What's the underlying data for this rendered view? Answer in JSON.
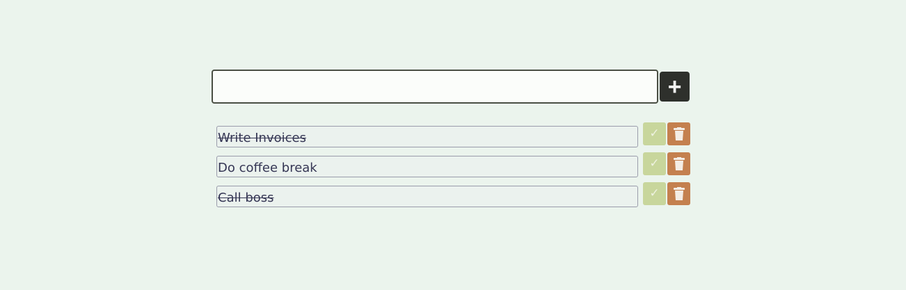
{
  "input": {
    "value": "",
    "placeholder": ""
  },
  "add_button": {
    "label": "+"
  },
  "tasks": [
    {
      "text": "Write Invoices",
      "done": true
    },
    {
      "text": "Do coffee break",
      "done": false
    },
    {
      "text": "Call boss",
      "done": true
    }
  ],
  "icons": {
    "check": "check-icon",
    "delete": "trash-icon"
  }
}
